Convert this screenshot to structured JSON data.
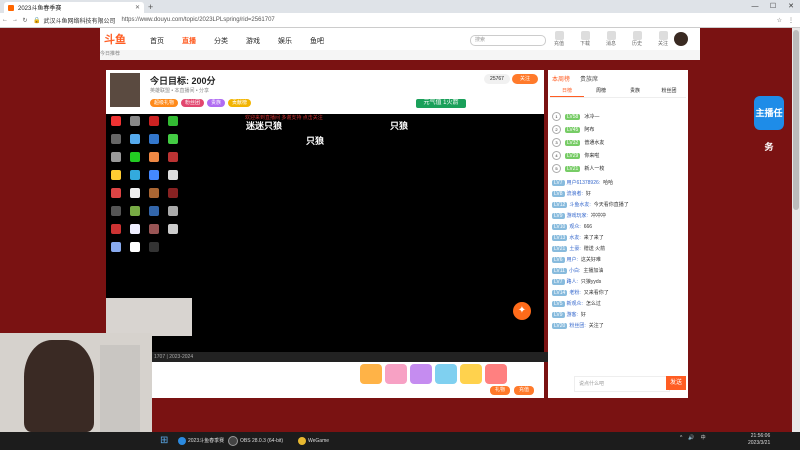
{
  "browser": {
    "tab_title": "2023斗鱼春季赛",
    "new_tab": "+",
    "window_controls": [
      "—",
      "☐",
      "✕"
    ],
    "site_name": "武汉斗鱼网络科技有限公司",
    "url": "https://www.douyu.com/topic/2023LPLspring/rid=2561707",
    "tools": [
      "☆",
      "⋮"
    ]
  },
  "site": {
    "logo": "斗鱼",
    "nav": [
      "首页",
      "直播",
      "分类",
      "游戏",
      "娱乐",
      "鱼吧"
    ],
    "active_nav": "直播",
    "search_placeholder": "搜索",
    "top_icons": [
      "充值",
      "下载",
      "消息",
      "历史",
      "关注"
    ],
    "subnav": "今日推荐"
  },
  "room": {
    "goal_label": "今日目标: 200分",
    "meta": "英雄联盟 • 本直播间 • 分享",
    "badges": [
      {
        "text": "超级礼物",
        "color": "#ff8a1a"
      },
      {
        "text": "粉丝团",
        "color": "#e2466e"
      },
      {
        "text": "贵族",
        "color": "#b06cf2"
      },
      {
        "text": "贡献榜",
        "color": "#f2b400"
      }
    ],
    "follow_count": "25767",
    "follow_label": "关注",
    "rank_badge": "元气值 1火箭"
  },
  "stream": {
    "title_left": "迷迷只狼",
    "title_right": "只狼",
    "title_center": "只狼",
    "red_text": "欢迎来到直播间 多谢支持 点击关注",
    "status_bar": "1707 | 2023-2024"
  },
  "right_panel": {
    "tabs": [
      "本周榜",
      "贵族席"
    ],
    "active_tab": "本周榜",
    "subtabs": [
      "日榜",
      "周榜",
      "贵族",
      "粉丝团"
    ],
    "active_subtab": "日榜",
    "rank": [
      {
        "num": "1",
        "lv": "LV58",
        "name": "冰冷—"
      },
      {
        "num": "2",
        "lv": "LV45",
        "name": "阿布"
      },
      {
        "num": "3",
        "lv": "LV32",
        "name": "普通水友"
      },
      {
        "num": "4",
        "lv": "LV29",
        "name": "你来啦"
      },
      {
        "num": "5",
        "lv": "LV21",
        "name": "新人一枚"
      }
    ],
    "chat": [
      {
        "lv": "LV7",
        "user": "用户61378926:",
        "text": "哈哈"
      },
      {
        "lv": "LV8",
        "user": "流浪者:",
        "text": "好"
      },
      {
        "lv": "LV12",
        "user": "斗鱼水友:",
        "text": "今天看你直播了"
      },
      {
        "lv": "LV9",
        "user": "游戏玩家:",
        "text": "冲冲冲"
      },
      {
        "lv": "LV10",
        "user": "观众:",
        "text": "666"
      },
      {
        "lv": "LV13",
        "user": "水友:",
        "text": "来了来了"
      },
      {
        "lv": "LV21",
        "user": "土豪:",
        "text": "赠送 火箭"
      },
      {
        "lv": "LV6",
        "user": "用户:",
        "text": "这关好难"
      },
      {
        "lv": "LV11",
        "user": "小白:",
        "text": "主播加油"
      },
      {
        "lv": "LV7",
        "user": "路人:",
        "text": "只狼yyds"
      },
      {
        "lv": "LV14",
        "user": "老粉:",
        "text": "又来看你了"
      },
      {
        "lv": "LV5",
        "user": "新观众:",
        "text": "怎么过"
      },
      {
        "lv": "LV9",
        "user": "游客:",
        "text": "好"
      },
      {
        "lv": "LV20",
        "user": "粉丝团:",
        "text": "关注了"
      }
    ],
    "chat_placeholder": "说点什么吧",
    "send": "发送"
  },
  "floating": {
    "task_badge": "主播任务",
    "fab": "✦"
  },
  "taskbar": {
    "start": "⊞",
    "items": [
      "2023斗鱼春季赛",
      "OBS 28.0.3 (64-bit)",
      "WeGame"
    ],
    "tray": [
      "^",
      "🔊",
      "中"
    ],
    "time": "21:56:06",
    "date": "2023/3/21"
  }
}
